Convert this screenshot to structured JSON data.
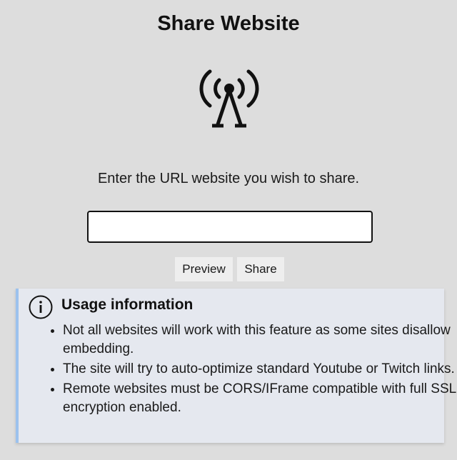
{
  "page": {
    "title": "Share Website",
    "prompt": "Enter the URL website you wish to share."
  },
  "url_input": {
    "value": "",
    "placeholder": ""
  },
  "buttons": {
    "preview": "Preview",
    "share": "Share"
  },
  "icons": {
    "broadcast": "broadcast-antenna-icon",
    "info": "info-circle-icon"
  },
  "usage_info": {
    "heading": "Usage information",
    "items": [
      "Not all websites will work with this feature as some sites disallow embedding.",
      "The site will try to auto-optimize standard Youtube or Twitch links.",
      "Remote websites must be CORS/IFrame compatible with full SSL-encryption enabled."
    ]
  },
  "colors": {
    "background": "#dddddd",
    "info_background": "#e5e8ef",
    "info_accent": "#9cc2ee",
    "button_background": "#eeeeee"
  }
}
